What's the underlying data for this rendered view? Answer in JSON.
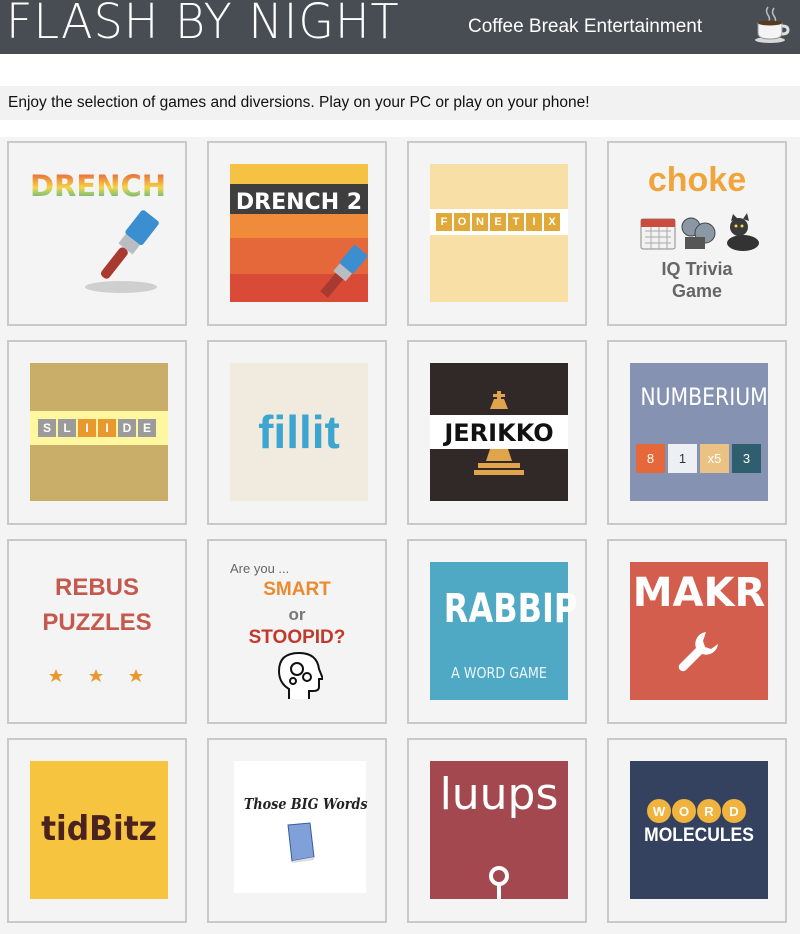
{
  "header": {
    "site_title": "FLASH BY NIGHT",
    "brand": "Coffee Break Entertainment",
    "cup_icon": "coffee-cup-icon",
    "background": "#474d53"
  },
  "intro": {
    "text": "Enjoy the selection of games and diversions. Play on your PC or play on your phone!"
  },
  "games": [
    {
      "key": "drench",
      "title": "DRENCH"
    },
    {
      "key": "drench2",
      "title": "DRENCH 2"
    },
    {
      "key": "fonetix",
      "title": "FONETIX",
      "letters": [
        "F",
        "O",
        "N",
        "E",
        "T",
        "I",
        "X"
      ]
    },
    {
      "key": "choke",
      "title": "choke",
      "subtitle_1": "IQ Trivia",
      "subtitle_2": "Game"
    },
    {
      "key": "sliide",
      "title": "SLIIDE",
      "letters": [
        "S",
        "L",
        "I",
        "I",
        "D",
        "E"
      ]
    },
    {
      "key": "fillit",
      "title": "fillit"
    },
    {
      "key": "jerikko",
      "title": "JERIKKO"
    },
    {
      "key": "numberium",
      "title": "NUMBERIUM",
      "tiles": [
        "8",
        "1",
        "x5",
        "3"
      ]
    },
    {
      "key": "rebus",
      "title_1": "REBUS",
      "title_2": "PUZZLES"
    },
    {
      "key": "smart",
      "line_1": "Are you ...",
      "line_2": "SMART",
      "line_3": "or",
      "line_4": "STOOPID?"
    },
    {
      "key": "rabbip",
      "title": "RABBIP",
      "subtitle": "A WORD GAME"
    },
    {
      "key": "makr",
      "title": "MAKR"
    },
    {
      "key": "tidbitz",
      "title": "tidBitz"
    },
    {
      "key": "bigwords",
      "title": "Those BIG Words"
    },
    {
      "key": "luups",
      "title": "luups"
    },
    {
      "key": "molecules",
      "title": "MOLECULES",
      "letters": [
        "W",
        "O",
        "R",
        "D"
      ]
    }
  ],
  "colors": {
    "drench2_stripes": [
      "#f6c244",
      "#ef8b3a",
      "#e5683b",
      "#d94a37"
    ],
    "fonetix_bg": "#f8dfa6",
    "sliide_bg": "#c9ae6a",
    "fillit_bg": "#f0ebde",
    "jerikko_bg": "#312927",
    "numberium_bg": "#8592b1",
    "rabbip_bg": "#4fa9c5",
    "makr_bg": "#d35e4d",
    "tidbitz_bg": "#f7c43f",
    "luups_bg": "#a4484f",
    "molecules_bg": "#344260"
  }
}
